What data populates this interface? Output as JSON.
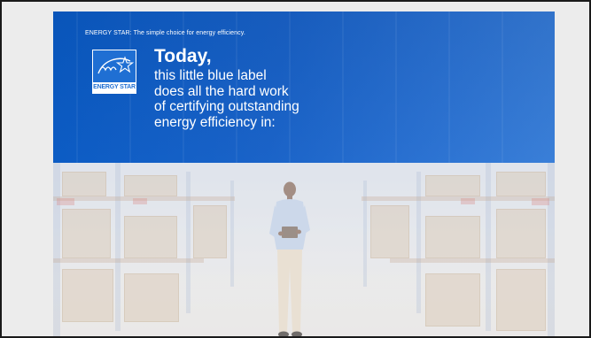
{
  "slide": {
    "tagline": "ENERGY STAR: The simple choice for energy efficiency.",
    "logo": {
      "icon": "energy-star-logo-icon",
      "caption": "ENERGY STAR"
    },
    "headline": "Today,",
    "body_lines": [
      "this little blue label",
      "does all the hard work",
      "of certifying outstanding",
      "energy efficiency in:"
    ],
    "photo": {
      "scene": "warehouse-aisle-with-person"
    }
  },
  "colors": {
    "header_blue": "#1a63c8",
    "logo_blue": "#1f6fd3",
    "text_white": "#ffffff",
    "frame_border": "#1a1a1a"
  }
}
